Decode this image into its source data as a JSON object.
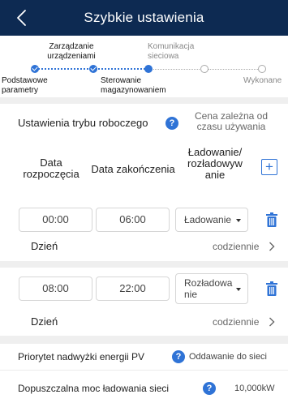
{
  "header": {
    "title": "Szybkie ustawienia",
    "back_icon": "chevron-left-icon"
  },
  "stepper": {
    "steps": [
      {
        "label": "Podstawowe\nparametry",
        "state": "done"
      },
      {
        "label": "Zarządzanie\nurządzeniami",
        "state": "done"
      },
      {
        "label": "Sterowanie\nmagazynowaniem",
        "state": "current"
      },
      {
        "label": "Komunikacja\nsieciowa",
        "state": "pending"
      },
      {
        "label": "Wykonane",
        "state": "pending"
      }
    ],
    "accent": "#2f73d6"
  },
  "mode": {
    "label": "Ustawienia trybu roboczego",
    "value": "Cena zależna od\nczasu używania",
    "help_icon": "question-icon"
  },
  "table": {
    "columns": [
      "Data\nrozpoczęcia",
      "Data zakończenia",
      "Ładowanie/\nrozładowyw\nanie"
    ],
    "add_icon": "plus-icon",
    "rows": [
      {
        "start": "00:00",
        "end": "06:00",
        "type": "Ładowanie",
        "day_label": "Dzień",
        "repeat": "codziennie"
      },
      {
        "start": "08:00",
        "end": "22:00",
        "type": "Rozładowa\nnie",
        "day_label": "Dzień",
        "repeat": "codziennie"
      }
    ]
  },
  "settings": {
    "pv_priority": {
      "label": "Priorytet nadwyżki energii PV",
      "value": "Oddawanie do sieci"
    },
    "grid_charge": {
      "label": "Dopuszczalna moc ładowania sieci",
      "value": "10,000kW"
    }
  },
  "colors": {
    "header_bg": "#0d2a52",
    "accent": "#2f73d6",
    "divider": "#efefef"
  }
}
